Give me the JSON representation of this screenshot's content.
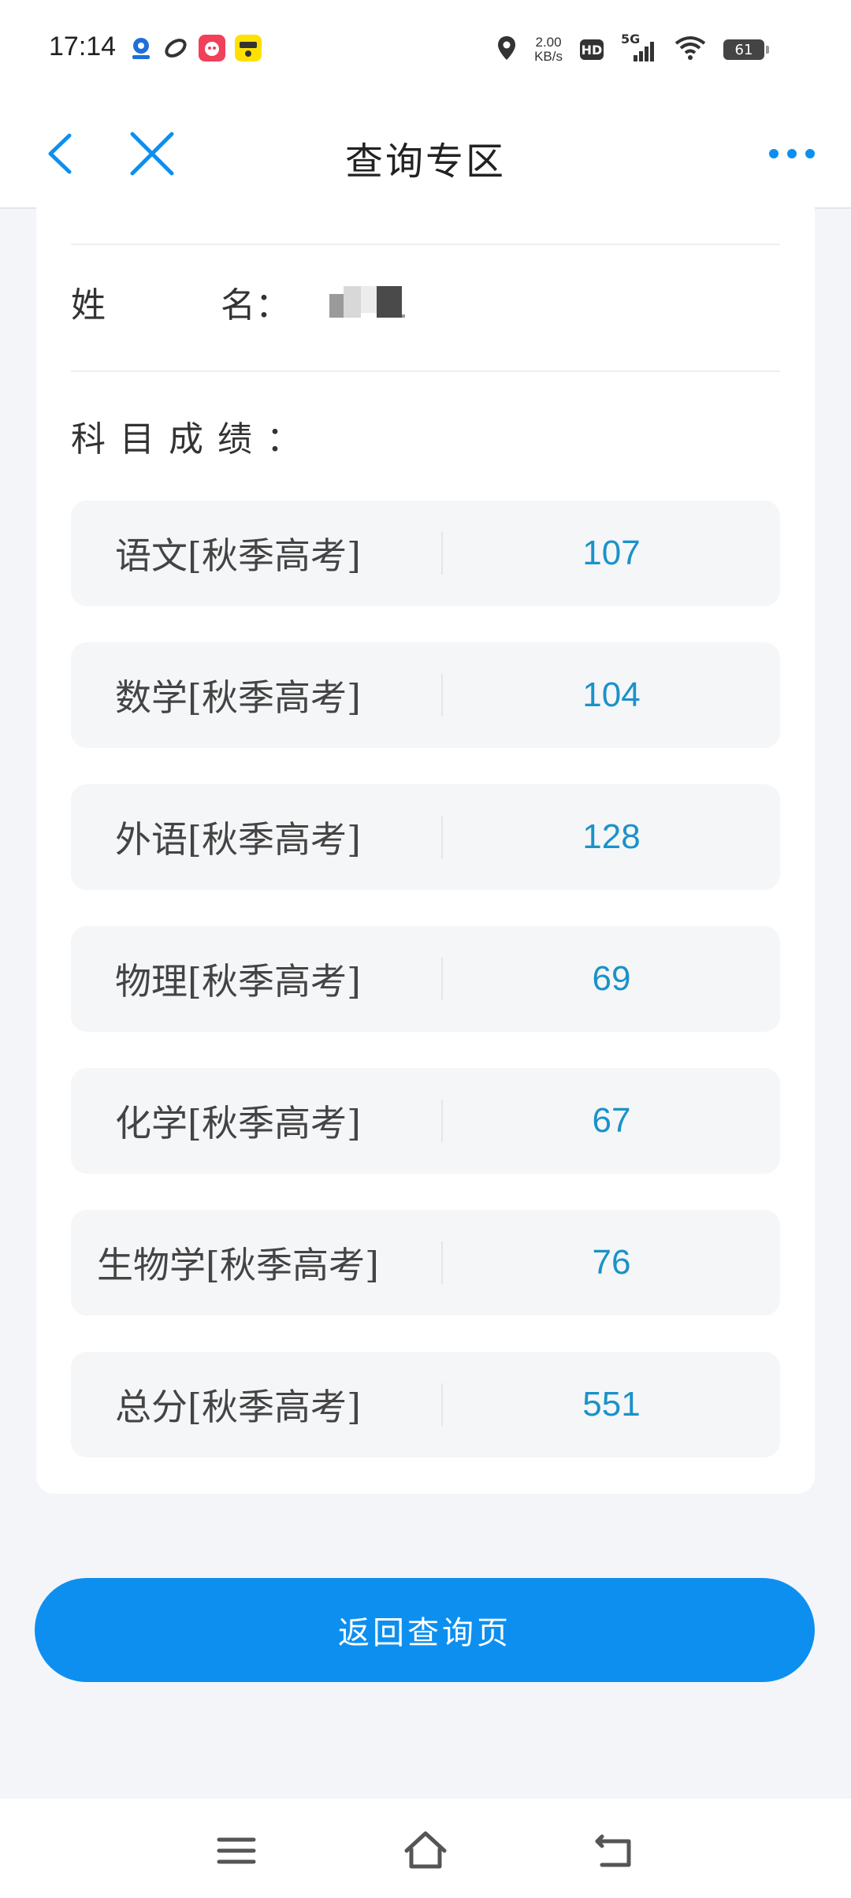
{
  "status_bar": {
    "time": "17:14",
    "net_speed_value": "2.00",
    "net_speed_unit": "KB/s",
    "hd_badge": "HD",
    "network_type": "5G",
    "battery_level": "61",
    "icons": [
      "location-icon",
      "wifi-icon",
      "signal-icon",
      "battery-icon"
    ]
  },
  "header": {
    "title": "查询专区",
    "icons": [
      "back-chevron-icon",
      "close-icon",
      "more-dots-icon"
    ],
    "accent_color": "#0d8ff0"
  },
  "result_card": {
    "name_label_first": "姓",
    "name_label_second": "名：",
    "name_value": "",
    "subjects_heading": "科目成绩：",
    "subjects": [
      {
        "label": "语文[秋季高考]",
        "score": "107"
      },
      {
        "label": "数学[秋季高考]",
        "score": "104"
      },
      {
        "label": "外语[秋季高考]",
        "score": "128"
      },
      {
        "label": "物理[秋季高考]",
        "score": "69"
      },
      {
        "label": "化学[秋季高考]",
        "score": "67"
      },
      {
        "label": "生物学[秋季高考]",
        "score": "76"
      },
      {
        "label": "总分[秋季高考]",
        "score": "551"
      }
    ],
    "score_color": "#1a92c9"
  },
  "actions": {
    "return_label": "返回查询页"
  },
  "nav_bar": {
    "icons": [
      "menu-icon",
      "home-icon",
      "back-icon"
    ]
  }
}
